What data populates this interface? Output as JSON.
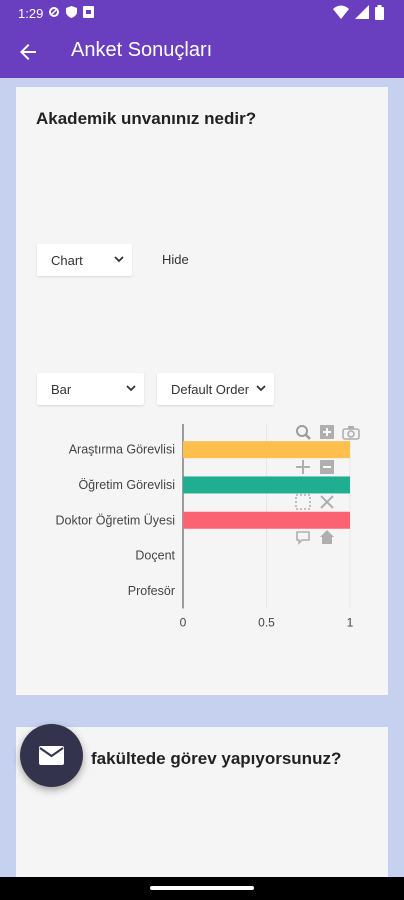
{
  "status_bar": {
    "time": "1:29",
    "icons": [
      "vpn-key-icon",
      "shield-icon",
      "document-icon",
      "wifi-icon",
      "signal-icon",
      "battery-icon"
    ]
  },
  "app_bar": {
    "title": "Anket Sonuçları",
    "back_icon": "arrow-back-icon"
  },
  "question1": {
    "title": "Akademik unvanınız nedir?",
    "view_select": "Chart",
    "hide_label": "Hide",
    "chart_type_select": "Bar",
    "order_select": "Default Order"
  },
  "chart_data": {
    "type": "bar",
    "orientation": "horizontal",
    "categories": [
      "Araştırma Görevlisi",
      "Öğretim Görevlisi",
      "Doktor Öğretim Üyesi",
      "Doçent",
      "Profesör"
    ],
    "values": [
      1,
      1,
      1,
      0,
      0
    ],
    "colors": [
      "#ffbf4d",
      "#1fae8f",
      "#fb6372",
      "#999999",
      "#999999"
    ],
    "xticks": [
      "0",
      "0.5",
      "1"
    ],
    "xlim": [
      0,
      1
    ],
    "grid": true
  },
  "modebar_icons": [
    "zoom-icon",
    "zoom-in-icon",
    "camera-icon",
    "pan-icon",
    "zoom-out-icon",
    "box-select-icon",
    "reset-axes-icon",
    "hover-compare-icon",
    "home-icon"
  ],
  "question2": {
    "title_visible": "fakültede görev yapıyorsunuz?"
  },
  "fab": {
    "icon": "mail-icon"
  },
  "colors": {
    "primary": "#6a3fbf",
    "page_bg": "#c6d1f0",
    "card_bg": "#f5f5f5",
    "fab_bg": "#33334d"
  }
}
